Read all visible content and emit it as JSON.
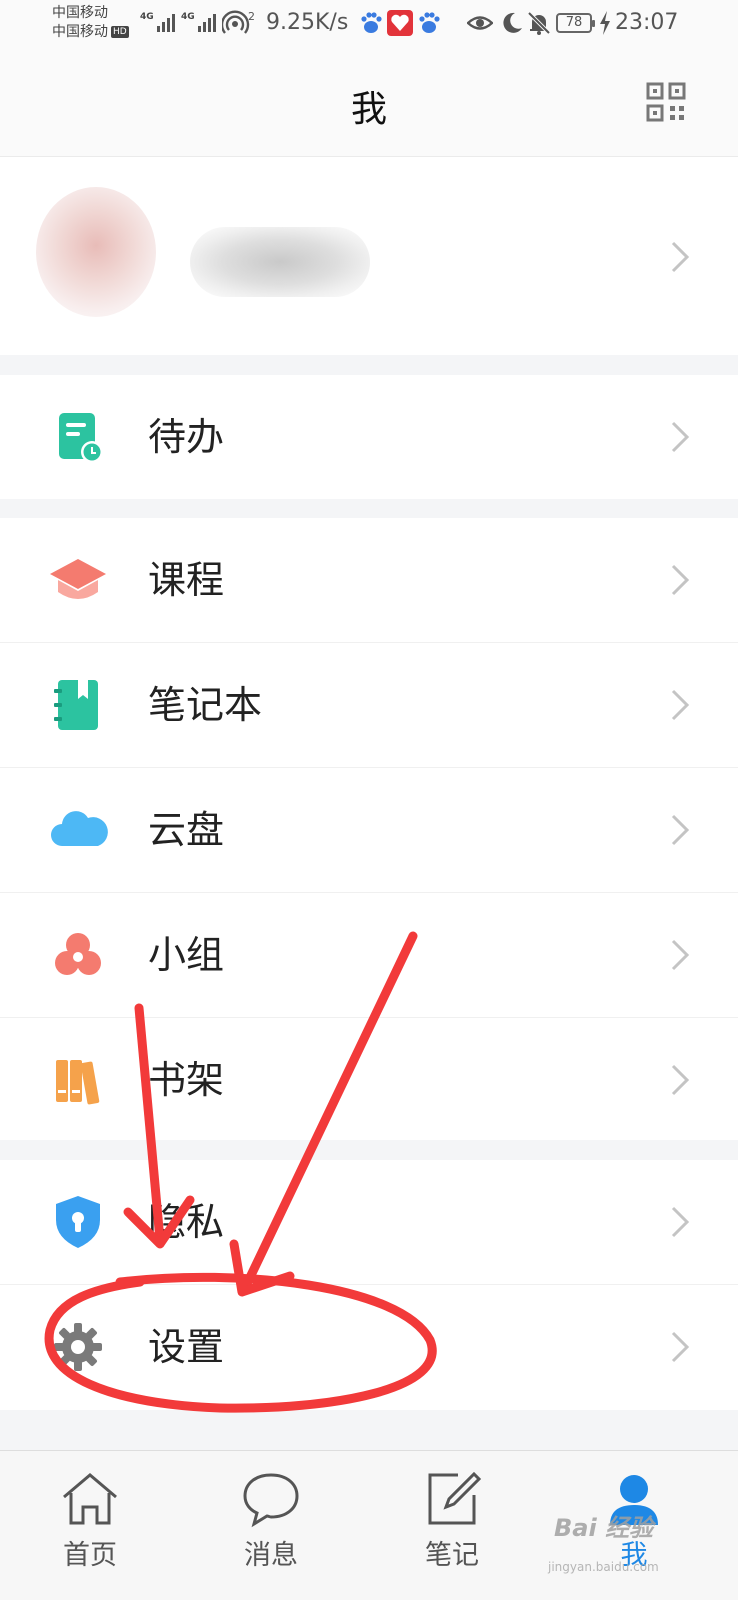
{
  "status_bar": {
    "carrier_1": "中国移动",
    "carrier_2": "中国移动",
    "hd_badge": "HD",
    "network_tag_1": "4G",
    "network_tag_2": "4G",
    "wifi_superscript": "2",
    "net_speed": "9.25K/s",
    "battery_level": "78",
    "time": "23:07",
    "icons": [
      "baidu-paw-icon",
      "app-red-icon",
      "baidu-paw-icon",
      "eye-icon",
      "moon-icon",
      "bell-off-icon",
      "charging-icon"
    ]
  },
  "header": {
    "title": "我",
    "right_icon": "qr-code-icon"
  },
  "menu": {
    "todo": {
      "label": "待办",
      "icon": "todo-icon",
      "color": "#2cc3a0"
    },
    "courses": {
      "label": "课程",
      "icon": "graduation-cap-icon",
      "color": "#f47b6f"
    },
    "notebook": {
      "label": "笔记本",
      "icon": "notebook-icon",
      "color": "#2cc3a0"
    },
    "cloud": {
      "label": "云盘",
      "icon": "cloud-icon",
      "color": "#4db8f5"
    },
    "group": {
      "label": "小组",
      "icon": "group-icon",
      "color": "#f47b6f"
    },
    "bookshelf": {
      "label": "书架",
      "icon": "bookshelf-icon",
      "color": "#f5a24b"
    },
    "privacy": {
      "label": "隐私",
      "icon": "shield-icon",
      "color": "#3aa0f0"
    },
    "settings": {
      "label": "设置",
      "icon": "gear-icon",
      "color": "#7a7a7a"
    }
  },
  "tabbar": {
    "home": "首页",
    "messages": "消息",
    "notes": "笔记",
    "me": "我",
    "active_color": "#1e88e5"
  },
  "watermark": {
    "brand": "Bai 经验",
    "site": "jingyan.baidu.com"
  },
  "annotation_color": "#f23a3a"
}
